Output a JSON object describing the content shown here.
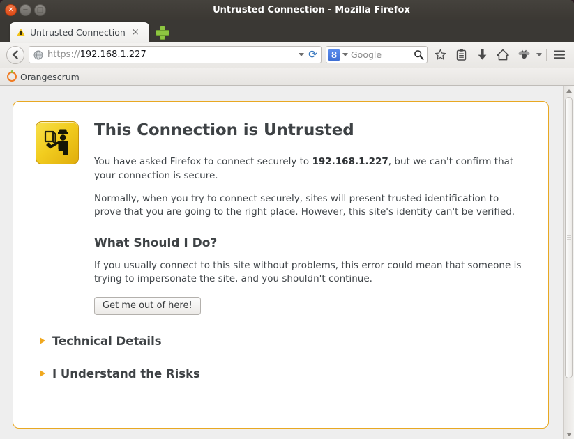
{
  "window": {
    "title": "Untrusted Connection - Mozilla Firefox",
    "close_label": "×",
    "minimize_label": "−",
    "maximize_label": "□"
  },
  "tabs": [
    {
      "label": "Untrusted Connection",
      "close_label": "×",
      "favicon": "warning-triangle-icon",
      "active": true
    }
  ],
  "newtab": {
    "label": "+"
  },
  "toolbar": {
    "back_icon": "back-arrow-icon",
    "url": {
      "scheme": "https://",
      "host": "192.168.1.227",
      "favicon": "globe-icon"
    },
    "url_dropdown_icon": "chevron-down-icon",
    "reload_label": "⟳",
    "search": {
      "engine": "Google",
      "engine_logo": "8",
      "placeholder": "Google",
      "search_icon": "magnifier-icon"
    },
    "icons": [
      {
        "name": "bookmark-star-icon",
        "glyph": "☆"
      },
      {
        "name": "reading-list-icon",
        "glyph": "Ὄb"
      },
      {
        "name": "downloads-icon",
        "glyph": "↓"
      },
      {
        "name": "home-icon",
        "glyph": "⌂"
      },
      {
        "name": "addon-bug-icon",
        "glyph": "🐞"
      },
      {
        "name": "overflow-chevron-icon",
        "glyph": "▾"
      },
      {
        "name": "hamburger-menu-icon",
        "glyph": "☰"
      }
    ]
  },
  "bookmarks": [
    {
      "label": "Orangescrum",
      "icon": "orangescrum-icon"
    }
  ],
  "page": {
    "icon": "guard-inspector-icon",
    "heading": "This Connection is Untrusted",
    "paragraph1_pre": "You have asked Firefox to connect securely to ",
    "paragraph1_host": "192.168.1.227",
    "paragraph1_post": ", but we can't confirm that your connection is secure.",
    "paragraph2": "Normally, when you try to connect securely, sites will present trusted identification to prove that you are going to the right place. However, this site's identity can't be verified.",
    "subheading": "What Should I Do?",
    "paragraph3": "If you usually connect to this site without problems, this error could mean that someone is trying to impersonate the site, and you shouldn't continue.",
    "button_label": "Get me out of here!",
    "expanders": [
      {
        "label": "Technical Details",
        "expanded": false
      },
      {
        "label": "I Understand the Risks",
        "expanded": false
      }
    ]
  },
  "colors": {
    "accent_yellow": "#e8a823",
    "titlebar": "#3b3833",
    "close_orange": "#dd4814",
    "heading": "#3e4245",
    "newtab_green": "#8ec641",
    "google_blue": "#3f6fd4"
  },
  "scrollbar": {
    "up_icon": "scroll-up-arrow-icon",
    "down_icon": "scroll-down-arrow-icon"
  }
}
